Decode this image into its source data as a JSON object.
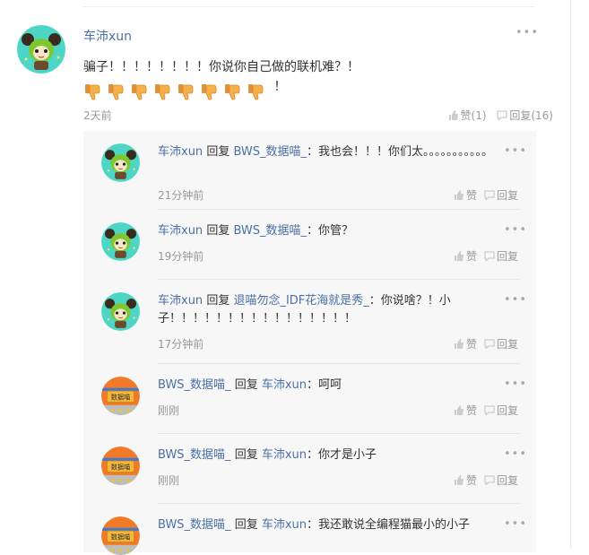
{
  "main_comment": {
    "username": "车沛xun",
    "text": "骗子！！！！！！！！你说你自己做的联机难？！",
    "thumbs_row1_count": 7,
    "after_thumbs": "！",
    "thumb_icon": "thumbs-down-emoji",
    "time": "2天前",
    "like_label": "赞(1)",
    "reply_label": "回复(16)"
  },
  "replies": [
    {
      "user": "车沛xun",
      "sep": " 回复 ",
      "to": "BWS_数据喵_",
      "text": "：我也会！！！你们太。。。。。。。。。。。",
      "time": "21分钟前",
      "like": "赞",
      "reply": "回复",
      "avatar": "green-cat-avatar"
    },
    {
      "user": "车沛xun",
      "sep": " 回复 ",
      "to": "BWS_数据喵_",
      "text": "：你管？",
      "time": "19分钟前",
      "like": "赞",
      "reply": "回复",
      "avatar": "green-cat-avatar"
    },
    {
      "user": "车沛xun",
      "sep": " 回复 ",
      "to": "退喵勿念_IDF花海就是秀_",
      "text": "：你说啥？！小子！！！！！！！！！！！！！！！！",
      "time": "17分钟前",
      "like": "赞",
      "reply": "回复",
      "avatar": "green-cat-avatar"
    },
    {
      "user": "BWS_数据喵_",
      "sep": " 回复 ",
      "to": "车沛xun",
      "text": "：呵呵",
      "time": "刚刚",
      "like": "赞",
      "reply": "回复",
      "avatar": "data-cat-badge-avatar",
      "badge_text": "数据喵"
    },
    {
      "user": "BWS_数据喵_",
      "sep": " 回复 ",
      "to": "车沛xun",
      "text": "：你才是小子",
      "time": "刚刚",
      "like": "赞",
      "reply": "回复",
      "avatar": "data-cat-badge-avatar",
      "badge_text": "数据喵"
    },
    {
      "user": "BWS_数据喵_",
      "sep": " 回复 ",
      "to": "车沛xun",
      "text": "：我还敢说全编程猫最小的小子",
      "time": "",
      "like": "",
      "reply": "",
      "avatar": "data-cat-badge-avatar",
      "badge_text": "数据喵"
    }
  ],
  "more_icon": "more-dots-icon",
  "colors": {
    "link": "#4a6fa5",
    "muted": "#999999",
    "reply_bg": "#f7f7f7"
  }
}
